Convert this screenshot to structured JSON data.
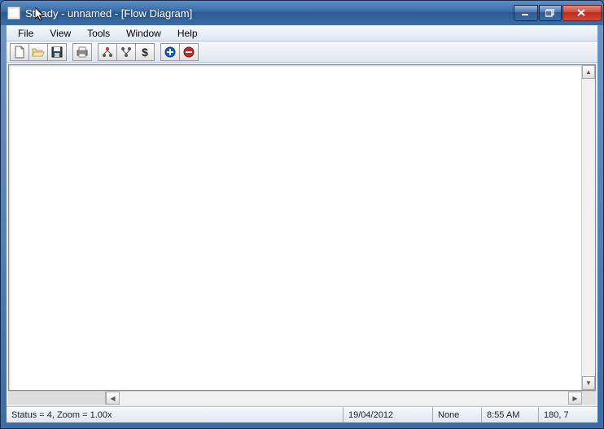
{
  "title": "Steady - unnamed - [Flow Diagram]",
  "menu": {
    "file": "File",
    "view": "View",
    "tools": "Tools",
    "window": "Window",
    "help": "Help"
  },
  "toolbar": {
    "new": "new-file-icon",
    "open": "open-folder-icon",
    "save": "save-floppy-icon",
    "print": "printer-icon",
    "group1": "tool1-icon",
    "group2": "tool2-icon",
    "dollar": "dollar-icon",
    "plus": "plus-circle-icon",
    "minus": "minus-circle-icon"
  },
  "status": {
    "main": "Status =  4, Zoom = 1.00x",
    "date": "19/04/2012",
    "mode": "None",
    "time": "8:55 AM",
    "coords": "180,  7"
  }
}
